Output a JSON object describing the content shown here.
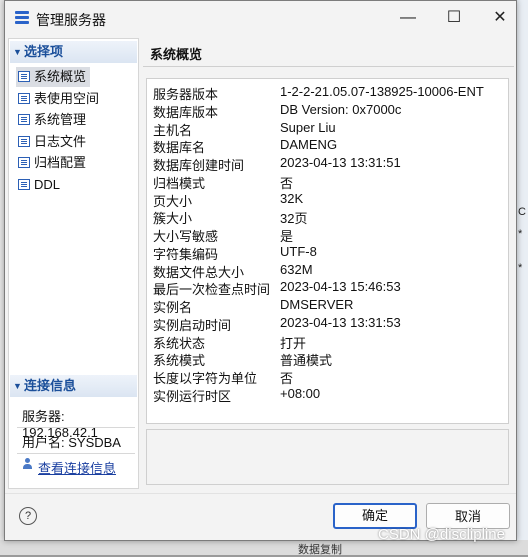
{
  "window": {
    "title": "管理服务器",
    "minimize_glyph": "—",
    "maximize_glyph": "☐",
    "close_glyph": "✕"
  },
  "left": {
    "select_header": "选择项",
    "nav": [
      {
        "label": "系统概览",
        "icon": "list-icon",
        "selected": true
      },
      {
        "label": "表使用空间",
        "icon": "list-icon"
      },
      {
        "label": "系统管理",
        "icon": "list-icon"
      },
      {
        "label": "日志文件",
        "icon": "list-icon"
      },
      {
        "label": "归档配置",
        "icon": "list-icon"
      },
      {
        "label": "DDL",
        "icon": "list-icon"
      }
    ],
    "conn_header": "连接信息",
    "server": "服务器: 192.168.42.1",
    "user": "用户名: SYSDBA",
    "view_conn": "查看连接信息"
  },
  "main": {
    "title": "系统概览",
    "rows": [
      {
        "k": "服务器版本",
        "v": "1-2-2-21.05.07-138925-10006-ENT"
      },
      {
        "k": "数据库版本",
        "v": "DB Version: 0x7000c"
      },
      {
        "k": "主机名",
        "v": "Super Liu"
      },
      {
        "k": "数据库名",
        "v": "DAMENG"
      },
      {
        "k": "数据库创建时间",
        "v": "2023-04-13 13:31:51"
      },
      {
        "k": "归档模式",
        "v": "否"
      },
      {
        "k": "页大小",
        "v": "32K"
      },
      {
        "k": "簇大小",
        "v": "32页"
      },
      {
        "k": "大小写敏感",
        "v": "是"
      },
      {
        "k": "字符集编码",
        "v": "UTF-8"
      },
      {
        "k": "数据文件总大小",
        "v": "632M"
      },
      {
        "k": "最后一次检查点时间",
        "v": "2023-04-13 15:46:53"
      },
      {
        "k": "实例名",
        "v": "DMSERVER"
      },
      {
        "k": "实例启动时间",
        "v": "2023-04-13 13:31:53"
      },
      {
        "k": "系统状态",
        "v": "打开"
      },
      {
        "k": "系统模式",
        "v": "普通模式"
      },
      {
        "k": "长度以字符为单位",
        "v": "否"
      },
      {
        "k": "实例运行时区",
        "v": "+08:00"
      }
    ]
  },
  "buttons": {
    "ok": "确定",
    "cancel": "取消",
    "help": "?"
  },
  "background": {
    "bottom_text": "数据复制"
  },
  "watermark": "CSDN @disclipline",
  "colors": {
    "accent": "#2a63c9",
    "header_text": "#1b4f9a",
    "link": "#1a3fa0"
  }
}
